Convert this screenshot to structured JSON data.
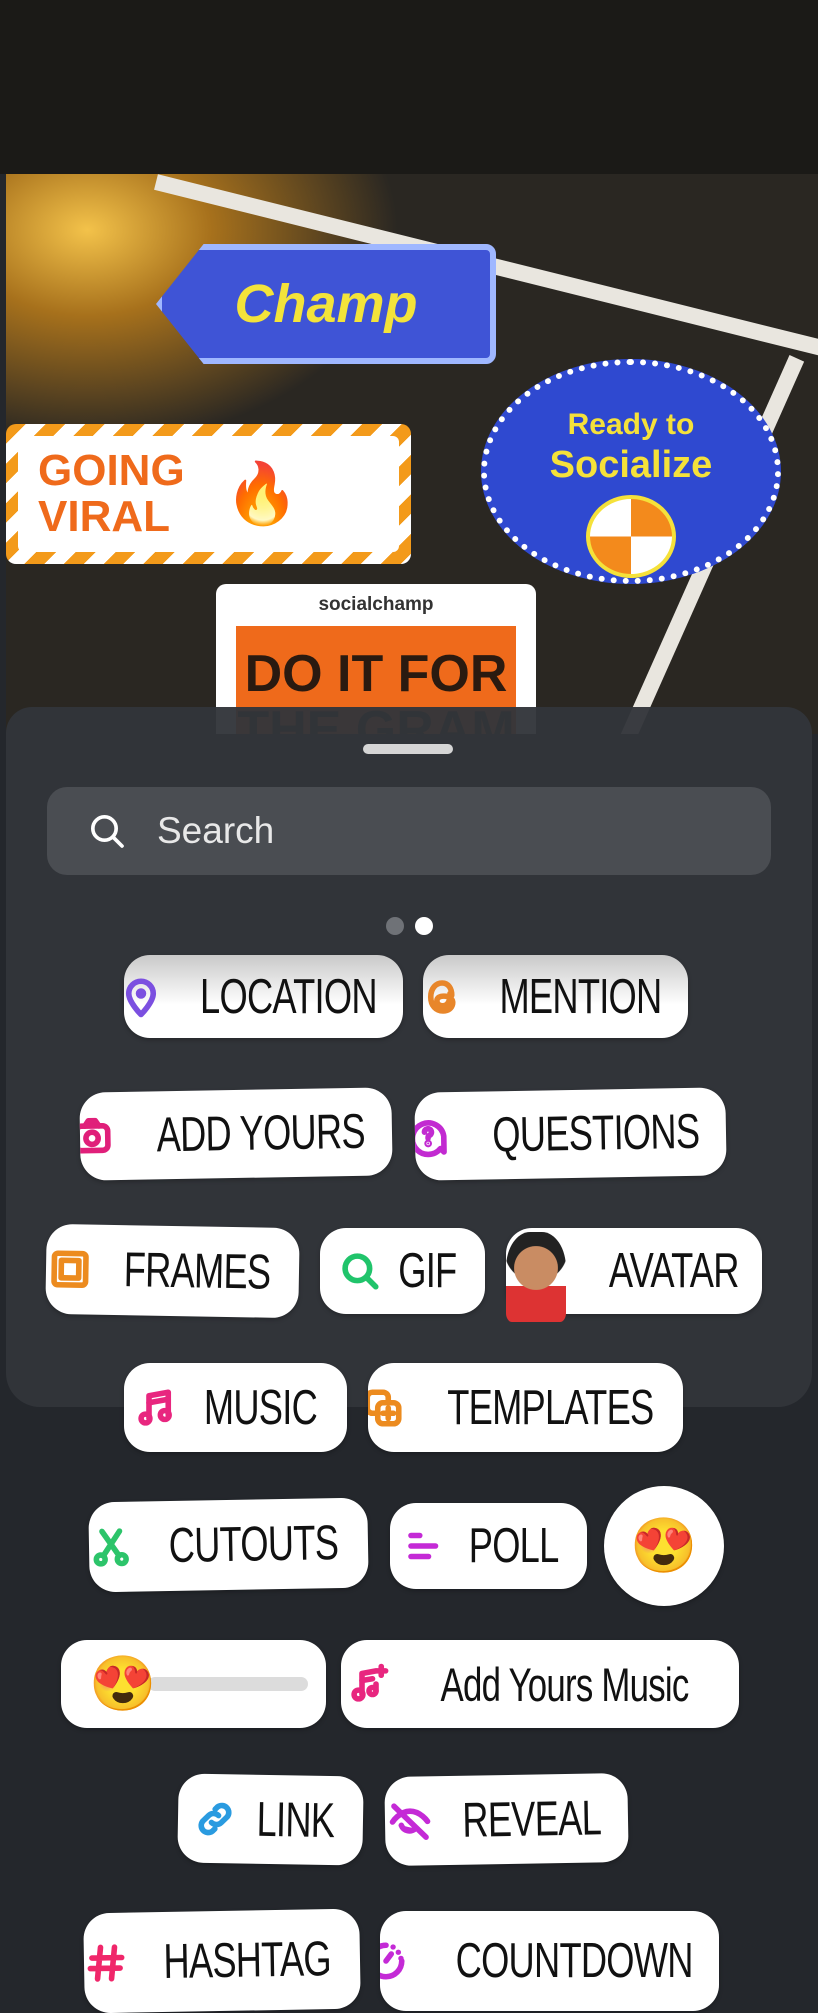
{
  "photo": {
    "champ": "Champ",
    "going_viral": [
      "GOING",
      "VIRAL"
    ],
    "socialize": [
      "Ready to",
      "Socialize"
    ],
    "card_brand": "socialchamp",
    "card_text": "DO IT FOR THE GRAM"
  },
  "search": {
    "placeholder": "Search"
  },
  "pager": {
    "pages": 2,
    "active": 2
  },
  "stickers": [
    {
      "label": "LOCATION",
      "icon": "location-pin-icon",
      "color": "#7b4fe0"
    },
    {
      "label": "MENTION",
      "icon": "threads-at-icon",
      "color": "#e8862a"
    },
    {
      "label": "ADD YOURS",
      "icon": "camera-icon",
      "color": "#e01f7a"
    },
    {
      "label": "QUESTIONS",
      "icon": "question-bubble-icon",
      "color": "#c22ad1"
    },
    {
      "label": "FRAMES",
      "icon": "frame-icon",
      "color": "#ec8b1f"
    },
    {
      "label": "GIF",
      "icon": "search-gif-icon",
      "color": "#20c46b"
    },
    {
      "label": "AVATAR",
      "icon": "avatar-icon"
    },
    {
      "label": "MUSIC",
      "icon": "music-note-icon",
      "color": "#e8267f"
    },
    {
      "label": "TEMPLATES",
      "icon": "templates-plus-icon",
      "color": "#ec8b1f"
    },
    {
      "label": "CUTOUTS",
      "icon": "scissors-icon",
      "color": "#2cc46a"
    },
    {
      "label": "POLL",
      "icon": "poll-lines-icon",
      "color": "#c42ad6"
    },
    {
      "label": "😍",
      "icon": "emoji-reaction"
    },
    {
      "label": "😍",
      "icon": "emoji-slider"
    },
    {
      "label": "Add Yours Music",
      "icon": "music-plus-icon",
      "color": "#e8267f"
    },
    {
      "label": "LINK",
      "icon": "link-icon",
      "color": "#2a9be0"
    },
    {
      "label": "REVEAL",
      "icon": "eye-off-icon",
      "color": "#c42ad6"
    },
    {
      "label": "HASHTAG",
      "icon": "hashtag-icon",
      "color": "#f0266a"
    },
    {
      "label": "COUNTDOWN",
      "icon": "timer-icon",
      "color": "#c42ad6"
    }
  ]
}
